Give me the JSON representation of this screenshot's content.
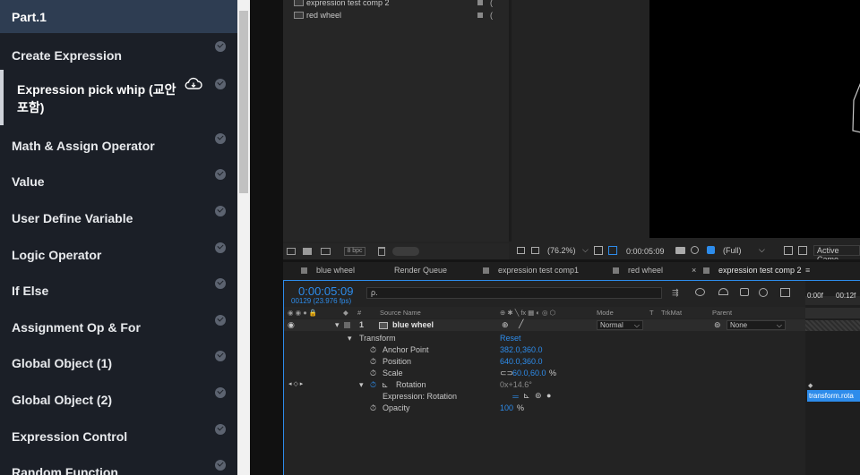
{
  "sidebar": {
    "section_title": "Part.1",
    "items": [
      {
        "label": "Create Expression",
        "completed": true
      },
      {
        "label": "Expression pick whip (교안 포함)",
        "active": true,
        "icon": "cloud-download-icon"
      },
      {
        "label": "Math & Assign Operator",
        "completed": true
      },
      {
        "label": "Value",
        "completed": true
      },
      {
        "label": "User Define Variable",
        "completed": true
      },
      {
        "label": "Logic Operator",
        "completed": true
      },
      {
        "label": "If Else",
        "completed": true
      },
      {
        "label": "Assignment Op & For",
        "completed": true
      },
      {
        "label": "Global Object (1)",
        "completed": true
      },
      {
        "label": "Global Object (2)",
        "completed": true
      },
      {
        "label": "Expression Control",
        "completed": true
      },
      {
        "label": "Random Function",
        "completed": true
      }
    ]
  },
  "project": {
    "items": [
      {
        "name": "expression test comp 2",
        "suffix": "("
      },
      {
        "name": "red wheel",
        "suffix": "("
      }
    ],
    "bpc": "8 bpc"
  },
  "viewer_toolbar": {
    "zoom": "(76.2%)",
    "timecode": "0:00:05:09",
    "resolution": "(Full)",
    "camera": "Active Came"
  },
  "tabs": [
    {
      "label": "blue wheel"
    },
    {
      "label": "Render Queue"
    },
    {
      "label": "expression test comp1"
    },
    {
      "label": "red wheel"
    },
    {
      "label": "expression test comp 2",
      "active": true
    }
  ],
  "timeline": {
    "timecode": "0:00:05:09",
    "fps": "00129 (23.976 fps)",
    "search_placeholder": "ρ.",
    "ruler_labels": [
      "0:00f",
      "00:12f"
    ],
    "columns": {
      "source_name": "Source Name",
      "mode": "Mode",
      "t": "T",
      "trkmat": "TrkMat",
      "parent": "Parent",
      "num": "#"
    },
    "layer": {
      "number": "1",
      "name": "blue wheel",
      "mode": "Normal",
      "parent": "None"
    },
    "transform": {
      "label": "Transform",
      "reset": "Reset"
    },
    "properties": [
      {
        "name": "Anchor Point",
        "value": "382.0,360.0"
      },
      {
        "name": "Position",
        "value": "640.0,360.0"
      },
      {
        "name": "Scale",
        "value": "60.0,60.0",
        "unit": "%"
      },
      {
        "name": "Rotation",
        "value": "0x+14.6°"
      },
      {
        "name": "Expression: Rotation",
        "value": ""
      },
      {
        "name": "Opacity",
        "value": "100",
        "unit": "%"
      }
    ],
    "expression_text": "transform.rota"
  },
  "colors": {
    "accent": "#2d8ceb",
    "sidebar_bg": "#1b1f27",
    "sidebar_header": "#2e3d52"
  }
}
